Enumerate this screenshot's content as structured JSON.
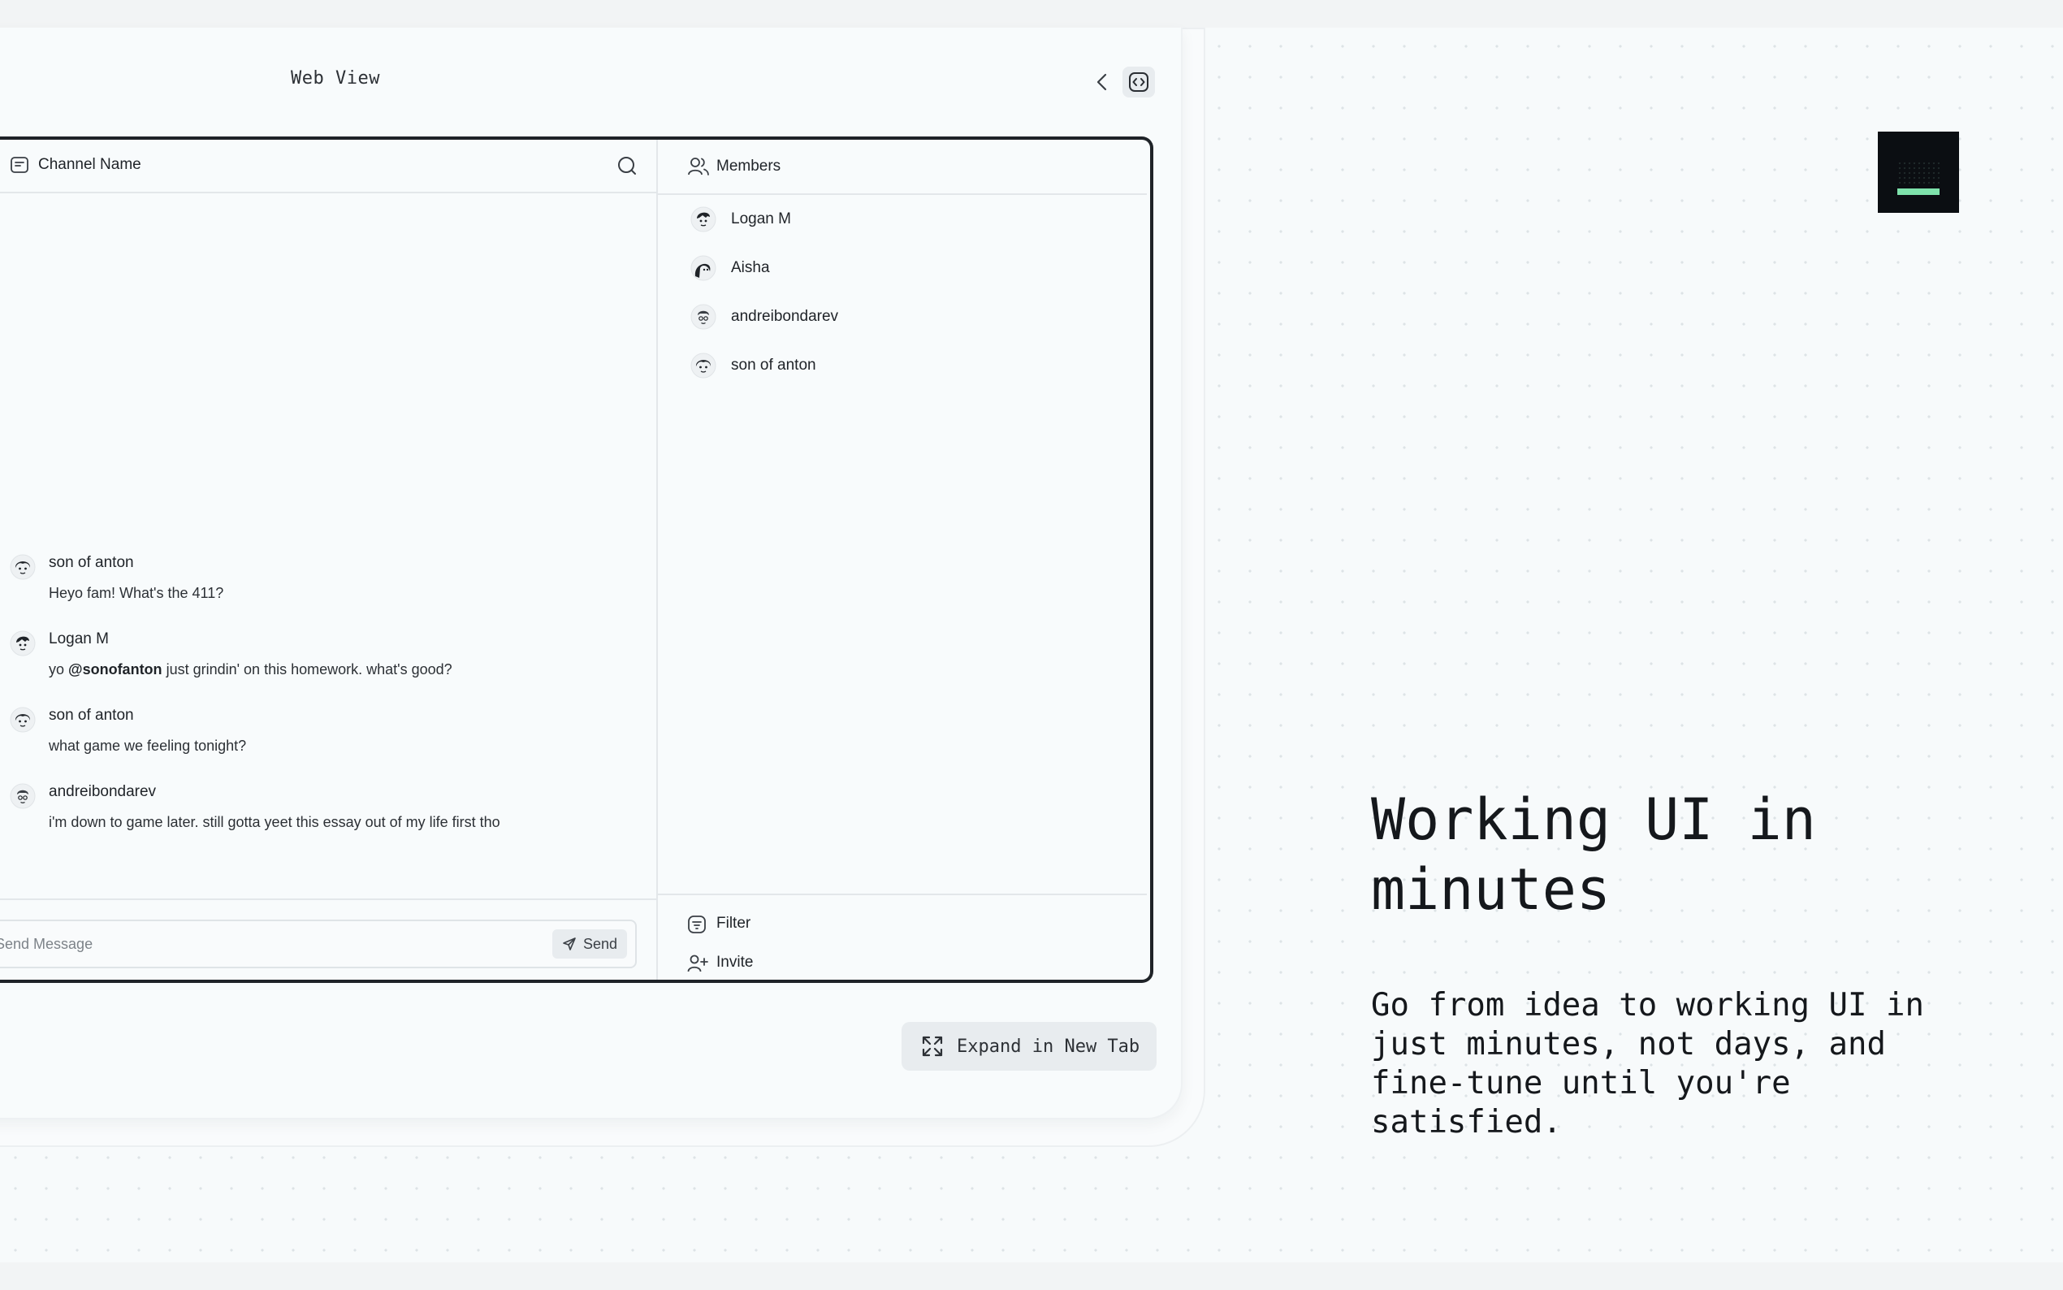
{
  "web_view": {
    "label": "Web View"
  },
  "chat": {
    "channel_name": "Channel Name",
    "messages": [
      {
        "author": "son of anton",
        "text": "Heyo fam! What's the 411?"
      },
      {
        "author": "Logan M",
        "text_before": "yo ",
        "mention": "@sonofanton",
        "text_after": " just grindin' on this homework. what's good?"
      },
      {
        "author": "son of anton",
        "text": "what game we feeling tonight?"
      },
      {
        "author": "andreibondarev",
        "text": "i'm down to game later. still gotta yeet this essay out of my life first tho"
      }
    ],
    "composer": {
      "placeholder": "Send Message",
      "send_label": "Send"
    }
  },
  "members": {
    "title": "Members",
    "list": [
      {
        "name": "Logan M"
      },
      {
        "name": "Aisha"
      },
      {
        "name": "andreibondarev"
      },
      {
        "name": "son of anton"
      }
    ],
    "filter_label": "Filter",
    "invite_label": "Invite"
  },
  "expand_button": {
    "label": "Expand in New Tab"
  },
  "hero": {
    "headline_line1": "Working UI in",
    "headline_line2": "minutes",
    "subtext_line1": "Go from idea to working UI in",
    "subtext_line2": "just minutes, not days, and",
    "subtext_line3": "fine-tune until you're",
    "subtext_line4": "satisfied."
  },
  "colors": {
    "background": "#f7fafb",
    "frame_border": "#1f2328",
    "logo_bg": "#0b0e12",
    "logo_accent": "#7ee2ab",
    "button_bg": "#e8ecef"
  }
}
